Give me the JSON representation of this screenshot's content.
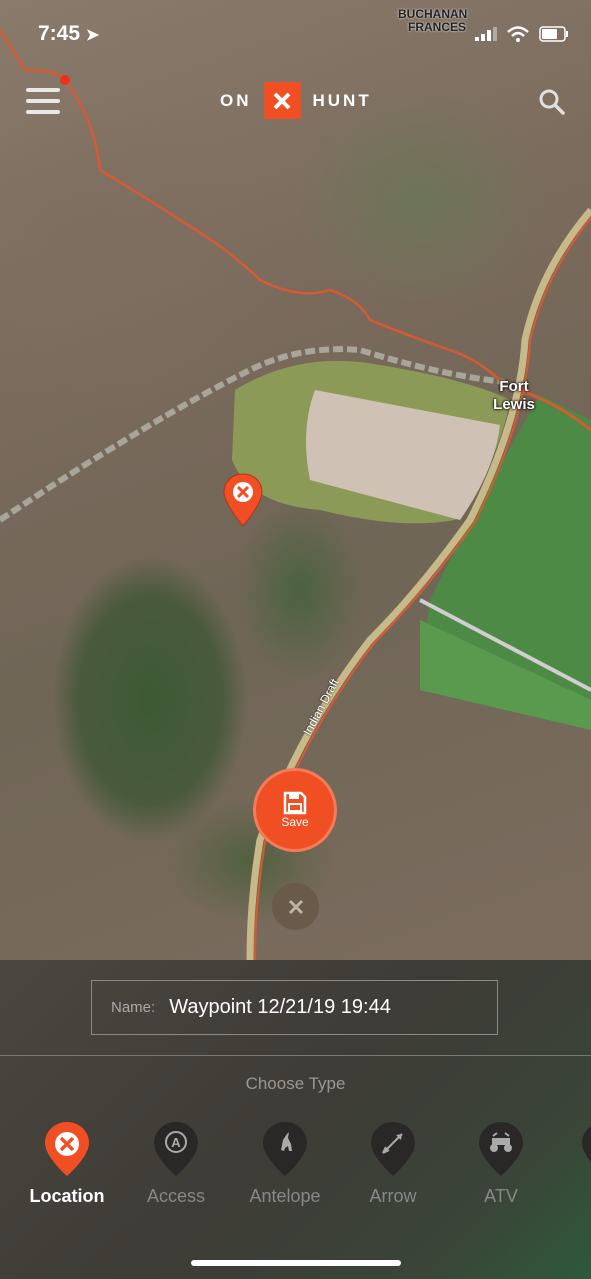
{
  "status": {
    "time": "7:45"
  },
  "header": {
    "logo_left": "ON",
    "logo_right": "HUNT"
  },
  "map_labels": {
    "corner_label_1": "BUCHANAN",
    "corner_label_2": "FRANCES",
    "town": "Fort Lewis",
    "road": "Indian Draft"
  },
  "actions": {
    "save_label": "Save"
  },
  "form": {
    "name_label": "Name:",
    "name_value": "Waypoint 12/21/19 19:44"
  },
  "chooser": {
    "title": "Choose Type",
    "types": [
      {
        "label": "Location",
        "icon": "location-x-icon",
        "active": true
      },
      {
        "label": "Access",
        "icon": "access-icon",
        "active": false
      },
      {
        "label": "Antelope",
        "icon": "antelope-icon",
        "active": false
      },
      {
        "label": "Arrow",
        "icon": "arrow-icon",
        "active": false
      },
      {
        "label": "ATV",
        "icon": "atv-icon",
        "active": false
      }
    ]
  },
  "colors": {
    "accent": "#f04e23",
    "sheet": "#3e3c36"
  }
}
